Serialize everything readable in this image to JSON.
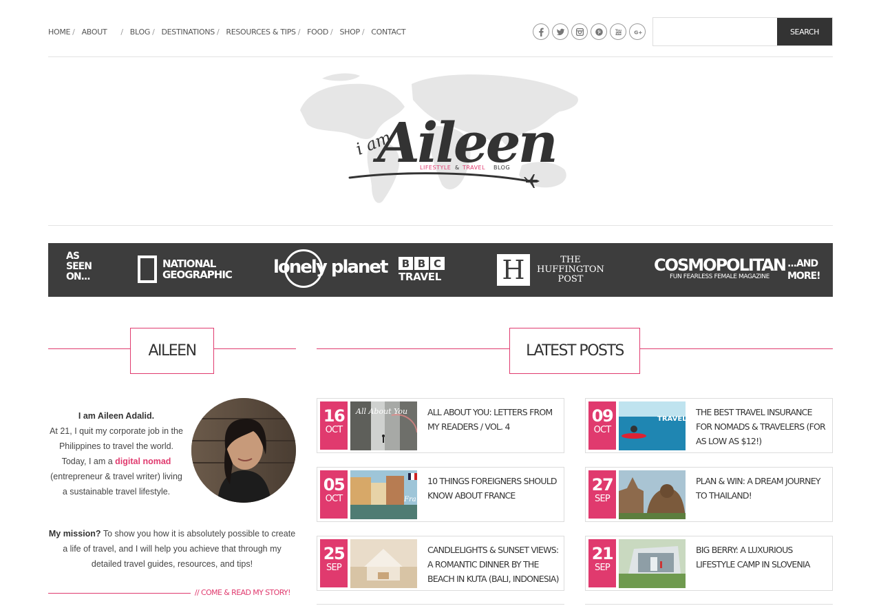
{
  "nav": {
    "items": [
      {
        "label": "HOME"
      },
      {
        "label": "ABOUT"
      },
      {
        "label": "BLOG"
      },
      {
        "label": "DESTINATIONS"
      },
      {
        "label": "RESOURCES & TIPS"
      },
      {
        "label": "FOOD"
      },
      {
        "label": "SHOP"
      },
      {
        "label": "CONTACT"
      }
    ],
    "separator": "/"
  },
  "social": [
    "facebook-icon",
    "twitter-icon",
    "instagram-icon",
    "pinterest-icon",
    "youtube-icon",
    "google-plus-icon"
  ],
  "search": {
    "placeholder": "",
    "value": "",
    "button_label": "SEARCH"
  },
  "logo": {
    "small": "i am",
    "big": "Aileen",
    "tagline_pink": "LIFESTYLE",
    "tagline_amp": "&",
    "tagline_pink2": "TRAVEL",
    "tagline_dark": "BLOG"
  },
  "seen_on": {
    "lead": [
      "AS",
      "SEEN",
      "ON..."
    ],
    "natgeo": [
      "NATIONAL",
      "GEOGRAPHIC"
    ],
    "lonely": "lonely planet",
    "bbc": [
      "B",
      "B",
      "C"
    ],
    "bbc_sub": "TRAVEL",
    "huff_letter": "H",
    "huff": [
      "THE",
      "HUFFINGTON",
      "POST"
    ],
    "cosmo": "COSMOPOLITAN",
    "cosmo_sub": "FUN FEARLESS FEMALE MAGAZINE",
    "more": [
      "...AND",
      "MORE!"
    ]
  },
  "about": {
    "heading": "AILEEN",
    "intro_bold": "I am Aileen Adalid.",
    "intro_1": "At 21, I quit my corporate job in the Philippines to travel the world. Today, I am a ",
    "intro_link": "digital nomad",
    "intro_2": " (entrepreneur & travel writer) living a sustainable travel lifestyle.",
    "mission_bold": "My mission?",
    "mission_text": " To show you how it is absolutely possible to create a life of travel, and I will help you achieve that through my detailed travel guides, resources, and tips!",
    "story_link": "// COME & READ MY STORY!"
  },
  "latest": {
    "heading": "LATEST POSTS",
    "posts": [
      {
        "day": "16",
        "month": "OCT",
        "title": "ALL ABOUT YOU: LETTERS FROM MY READERS / VOL. 4",
        "thumb_text": "All About You"
      },
      {
        "day": "09",
        "month": "OCT",
        "title": "THE BEST TRAVEL INSURANCE FOR NOMADS & TRAVELERS (FOR AS LOW AS $12!)",
        "thumb_text": "TRAVEL INSURANCE"
      },
      {
        "day": "05",
        "month": "OCT",
        "title": "10 THINGS FOREIGNERS SHOULD KNOW ABOUT FRANCE",
        "thumb_text": "Fra"
      },
      {
        "day": "27",
        "month": "SEP",
        "title": "PLAN & WIN: A DREAM JOURNEY TO THAILAND!",
        "thumb_text": ""
      },
      {
        "day": "25",
        "month": "SEP",
        "title": "CANDLELIGHTS & SUNSET VIEWS: A ROMANTIC DINNER BY THE BEACH IN KUTA (BALI, INDONESIA)",
        "thumb_text": ""
      },
      {
        "day": "21",
        "month": "SEP",
        "title": "BIG BERRY: A LUXURIOUS LIFESTYLE CAMP IN SLOVENIA",
        "thumb_text": ""
      }
    ]
  },
  "colors": {
    "accent": "#e03a6e",
    "dark_band": "#3d3d3d",
    "text": "#333333"
  }
}
